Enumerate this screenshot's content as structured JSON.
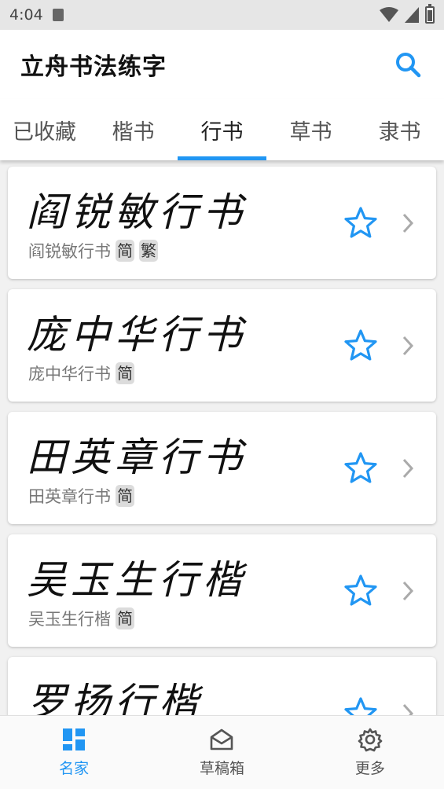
{
  "status_bar": {
    "time": "4:04"
  },
  "app_bar": {
    "title": "立舟书法练字",
    "search_icon": "search-icon"
  },
  "tabs": [
    {
      "label": "已收藏",
      "active": false
    },
    {
      "label": "楷书",
      "active": false
    },
    {
      "label": "行书",
      "active": true
    },
    {
      "label": "草书",
      "active": false
    },
    {
      "label": "隶书",
      "active": false
    }
  ],
  "fonts": [
    {
      "preview": "阎锐敏行书",
      "name": "阎锐敏行书",
      "tags": [
        "简",
        "繁"
      ]
    },
    {
      "preview": "庞中华行书",
      "name": "庞中华行书",
      "tags": [
        "简"
      ]
    },
    {
      "preview": "田英章行书",
      "name": "田英章行书",
      "tags": [
        "简"
      ]
    },
    {
      "preview": "吴玉生行楷",
      "name": "吴玉生行楷",
      "tags": [
        "简"
      ]
    },
    {
      "preview": "罗扬行楷",
      "name": "",
      "tags": []
    }
  ],
  "bottom_nav": [
    {
      "label": "名家",
      "icon": "dashboard-icon",
      "active": true
    },
    {
      "label": "草稿箱",
      "icon": "mail-open-icon",
      "active": false
    },
    {
      "label": "更多",
      "icon": "gear-icon",
      "active": false
    }
  ],
  "colors": {
    "accent": "#2196F3",
    "status_bar_bg": "#e6e6e6",
    "list_bg": "#f1f1f1",
    "tag_bg": "#dcdcdc"
  }
}
